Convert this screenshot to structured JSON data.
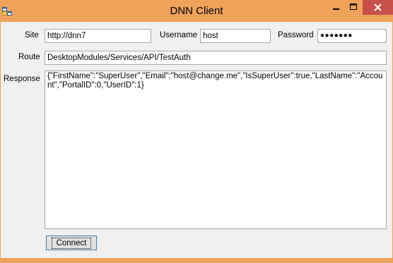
{
  "window": {
    "title": "DNN Client",
    "colors": {
      "frame": "#eea25a",
      "close_button": "#c7504b",
      "client_bg": "#f0f0f0"
    }
  },
  "form": {
    "site_label": "Site",
    "site_value": "http://dnn7",
    "username_label": "Username",
    "username_value": "host",
    "password_label": "Password",
    "password_masked": "●●●●●●●",
    "route_label": "Route",
    "route_value": "DesktopModules/Services/API/TestAuth",
    "response_label": "Response",
    "response_value": "{\"FirstName\":\"SuperUser\",\"Email\":\"host@change.me\",\"IsSuperUser\":true,\"LastName\":\"Account\",\"PortalID\":0,\"UserID\":1}",
    "connect_label": "Connect"
  }
}
